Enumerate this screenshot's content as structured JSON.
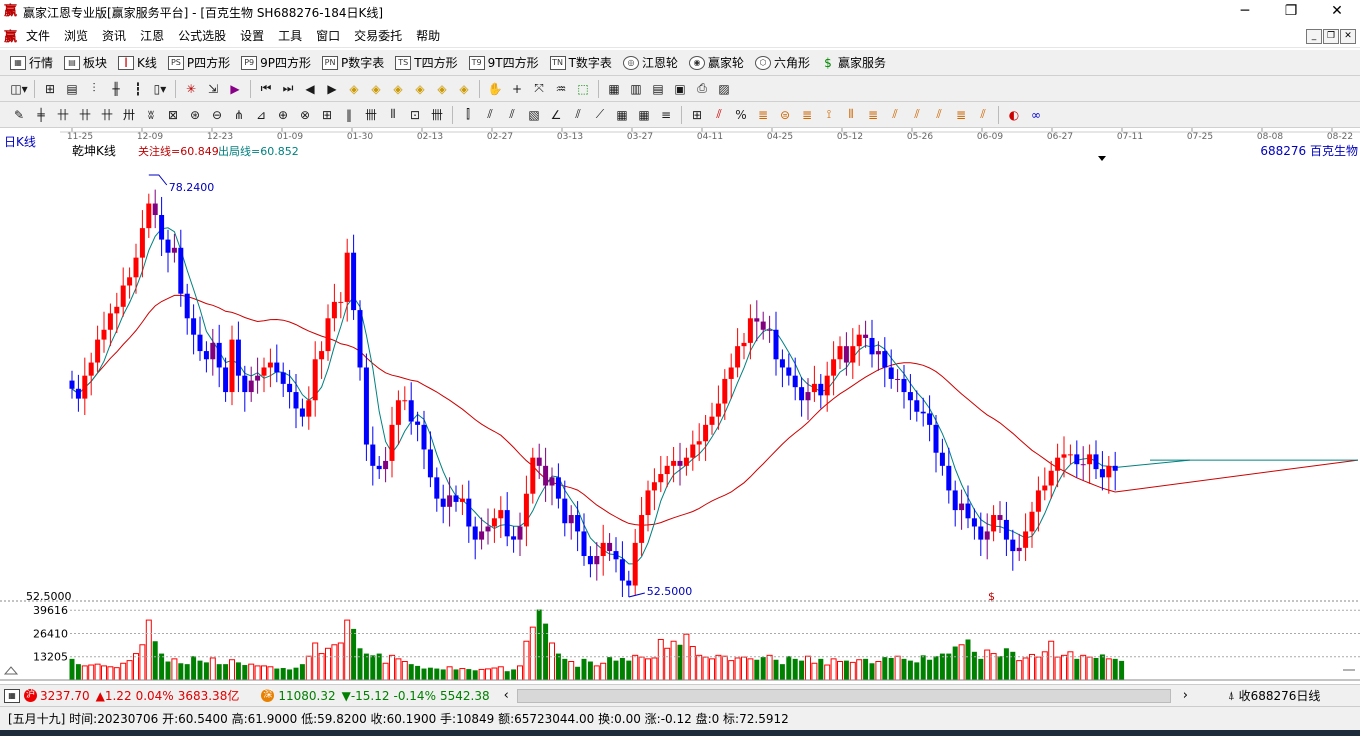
{
  "window": {
    "title": "赢家江恩专业版[赢家服务平台] - [百克生物   SH688276-184日K线]",
    "controls": [
      "─",
      "❐",
      "✕"
    ]
  },
  "menu": [
    "文件",
    "浏览",
    "资讯",
    "江恩",
    "公式选股",
    "设置",
    "工具",
    "窗口",
    "交易委托",
    "帮助"
  ],
  "mdi_controls": [
    "_",
    "❐",
    "✕"
  ],
  "nav": [
    {
      "label": "行情",
      "icon": "grid-icon"
    },
    {
      "label": "板块",
      "icon": "blocks-icon"
    },
    {
      "label": "K线",
      "icon": "candle-icon"
    },
    {
      "label": "P四方形",
      "icon": "ps-icon",
      "tag": "PS"
    },
    {
      "label": "9P四方形",
      "icon": "p9-icon",
      "tag": "P9"
    },
    {
      "label": "P数字表",
      "icon": "pn-icon",
      "tag": "PN"
    },
    {
      "label": "T四方形",
      "icon": "ts-icon",
      "tag": "TS"
    },
    {
      "label": "9T四方形",
      "icon": "t9-icon",
      "tag": "T9"
    },
    {
      "label": "T数字表",
      "icon": "tn-icon",
      "tag": "TN"
    },
    {
      "label": "江恩轮",
      "icon": "wheel-icon"
    },
    {
      "label": "赢家轮",
      "icon": "wheel2-icon"
    },
    {
      "label": "六角形",
      "icon": "hexagon-icon"
    },
    {
      "label": "赢家服务",
      "icon": "dollar-icon"
    }
  ],
  "chart": {
    "period_label": "日K线",
    "indicator_label": "乾坤K线",
    "attention_line": "关注线=60.849",
    "exit_line": "出局线=60.852",
    "stock_label": "688276  百克生物",
    "high_label": "78.2400",
    "low_label": "52.5000",
    "price_axis_label": "52.5000",
    "vol_ticks": [
      "39616",
      "26410",
      "13205"
    ],
    "dollar_mark": "$",
    "date_ticks": [
      "11-25",
      "12-09",
      "12-23",
      "01-09",
      "01-30",
      "02-13",
      "02-27",
      "03-13",
      "03-27",
      "04-11",
      "04-25",
      "05-12",
      "05-26",
      "06-09",
      "06-27",
      "07-11",
      "07-25",
      "08-08",
      "08-22"
    ],
    "colors": {
      "up": "#ff0000",
      "down": "#0000ff",
      "purple": "#800080",
      "ma_long": "#cc0000",
      "ma_short": "#008080",
      "vol_up": "#ff0000",
      "vol_down": "#008000"
    }
  },
  "chart_data": {
    "type": "candlestick",
    "price_range": [
      52.5,
      78.24
    ],
    "high": 78.24,
    "low": 52.5,
    "volume_ticks": [
      39616,
      26410,
      13205
    ],
    "x_ticks": [
      "11-25",
      "12-09",
      "12-23",
      "01-09",
      "01-30",
      "02-13",
      "02-27",
      "03-13",
      "03-27",
      "04-11",
      "04-25",
      "05-12",
      "05-26",
      "06-09",
      "06-27",
      "07-11",
      "07-25",
      "08-08",
      "08-22"
    ],
    "close": [
      65.2,
      64.6,
      66.0,
      66.8,
      68.2,
      68.8,
      69.8,
      70.2,
      71.5,
      72.0,
      73.2,
      75.0,
      76.5,
      75.8,
      74.3,
      73.5,
      73.8,
      71.0,
      69.5,
      68.5,
      67.5,
      67.0,
      68.0,
      66.5,
      65.0,
      68.2,
      66.0,
      65.0,
      65.7,
      66.0,
      66.5,
      66.8,
      66.2,
      65.5,
      65.0,
      64.0,
      63.5,
      64.5,
      67.0,
      67.5,
      69.5,
      70.5,
      70.5,
      73.5,
      70.0,
      66.5,
      61.8,
      60.5,
      60.3,
      60.8,
      63.0,
      64.5,
      64.5,
      63.2,
      63.0,
      61.5,
      59.8,
      58.5,
      58.0,
      58.7,
      58.3,
      58.5,
      56.8,
      56.0,
      56.5,
      56.8,
      57.3,
      57.8,
      56.2,
      56.0,
      56.8,
      58.8,
      61.0,
      60.5,
      59.3,
      59.8,
      58.5,
      57.0,
      57.5,
      56.5,
      55.0,
      54.5,
      55.0,
      55.8,
      55.3,
      54.8,
      53.5,
      53.2,
      55.8,
      57.5,
      59.0,
      59.5,
      60.0,
      60.5,
      60.8,
      60.5,
      61.0,
      61.8,
      62.0,
      63.0,
      63.5,
      64.3,
      65.8,
      66.5,
      67.8,
      68.0,
      69.5,
      69.3,
      68.8,
      68.8,
      67.0,
      66.5,
      66.0,
      65.3,
      64.5,
      65.0,
      65.5,
      64.8,
      66.0,
      67.0,
      67.8,
      66.8,
      67.8,
      68.5,
      68.3,
      67.3,
      67.5,
      66.5,
      65.8,
      65.8,
      65.0,
      64.5,
      63.8,
      63.7,
      63.0,
      61.3,
      60.5,
      59.0,
      57.8,
      58.2,
      57.3,
      56.8,
      56.0,
      56.5,
      57.5,
      57.2,
      56.0,
      55.3,
      55.5,
      56.5,
      57.7,
      59.0,
      59.3,
      60.2,
      61.0,
      61.2,
      61.2,
      60.6,
      60.6,
      61.2,
      60.3,
      59.8,
      60.5,
      60.2
    ],
    "volume": [
      12000,
      9000,
      8000,
      8500,
      9000,
      8000,
      7500,
      7000,
      9500,
      11000,
      15000,
      20000,
      34000,
      22000,
      15000,
      10500,
      12000,
      9500,
      9000,
      13500,
      11000,
      10000,
      12500,
      9000,
      9000,
      11500,
      10000,
      8500,
      9000,
      8000,
      8000,
      7500,
      6500,
      6800,
      6000,
      7000,
      9000,
      13500,
      21000,
      15000,
      18000,
      20000,
      21000,
      34000,
      29000,
      18000,
      15000,
      14000,
      15000,
      9500,
      14000,
      12000,
      10500,
      9000,
      8000,
      6500,
      7000,
      6500,
      6000,
      7500,
      6000,
      6500,
      6200,
      5500,
      6000,
      6300,
      6800,
      7500,
      5000,
      6000,
      8000,
      22000,
      30000,
      40000,
      32000,
      21000,
      15000,
      12000,
      10500,
      7500,
      12000,
      10500,
      8000,
      9500,
      13000,
      11000,
      12500,
      11000,
      14000,
      13000,
      12000,
      12500,
      23000,
      18000,
      22000,
      20000,
      26000,
      19000,
      14000,
      13000,
      12000,
      14000,
      13500,
      11000,
      12500,
      13000,
      12000,
      11500,
      13000,
      14000,
      11500,
      9000,
      13500,
      12000,
      11000,
      13500,
      9500,
      12000,
      8500,
      12000,
      10500,
      11000,
      10000,
      11500,
      12000,
      9500,
      10500,
      13000,
      12500,
      13500,
      12000,
      11000,
      10000,
      14000,
      11500,
      13500,
      15000,
      15000,
      19000,
      20000,
      23000,
      16000,
      12000,
      17000,
      15000,
      13500,
      18000,
      16000,
      11000,
      12500,
      14500,
      13000,
      16000,
      22000,
      13000,
      14000,
      16000,
      12000,
      14000,
      13000,
      12500,
      14500,
      12000,
      12000,
      10849
    ]
  },
  "status1": {
    "sh_value": "3237.70",
    "sh_change": "▲1.22",
    "sh_pct": "0.04%",
    "sh_amount": "3683.38亿",
    "sz_value": "11080.32",
    "sz_change": "▼-15.12",
    "sz_pct": "-0.14%",
    "sz_amount": "5542.38",
    "right_label": "收688276日线"
  },
  "status2": {
    "text": "[五月十九] 时间:20230706 开:60.5400 高:61.9000 低:59.8200 收:60.1900 手:10849 额:65723044.00 换:0.00 涨:-0.12 盘:0 标:72.5912"
  }
}
